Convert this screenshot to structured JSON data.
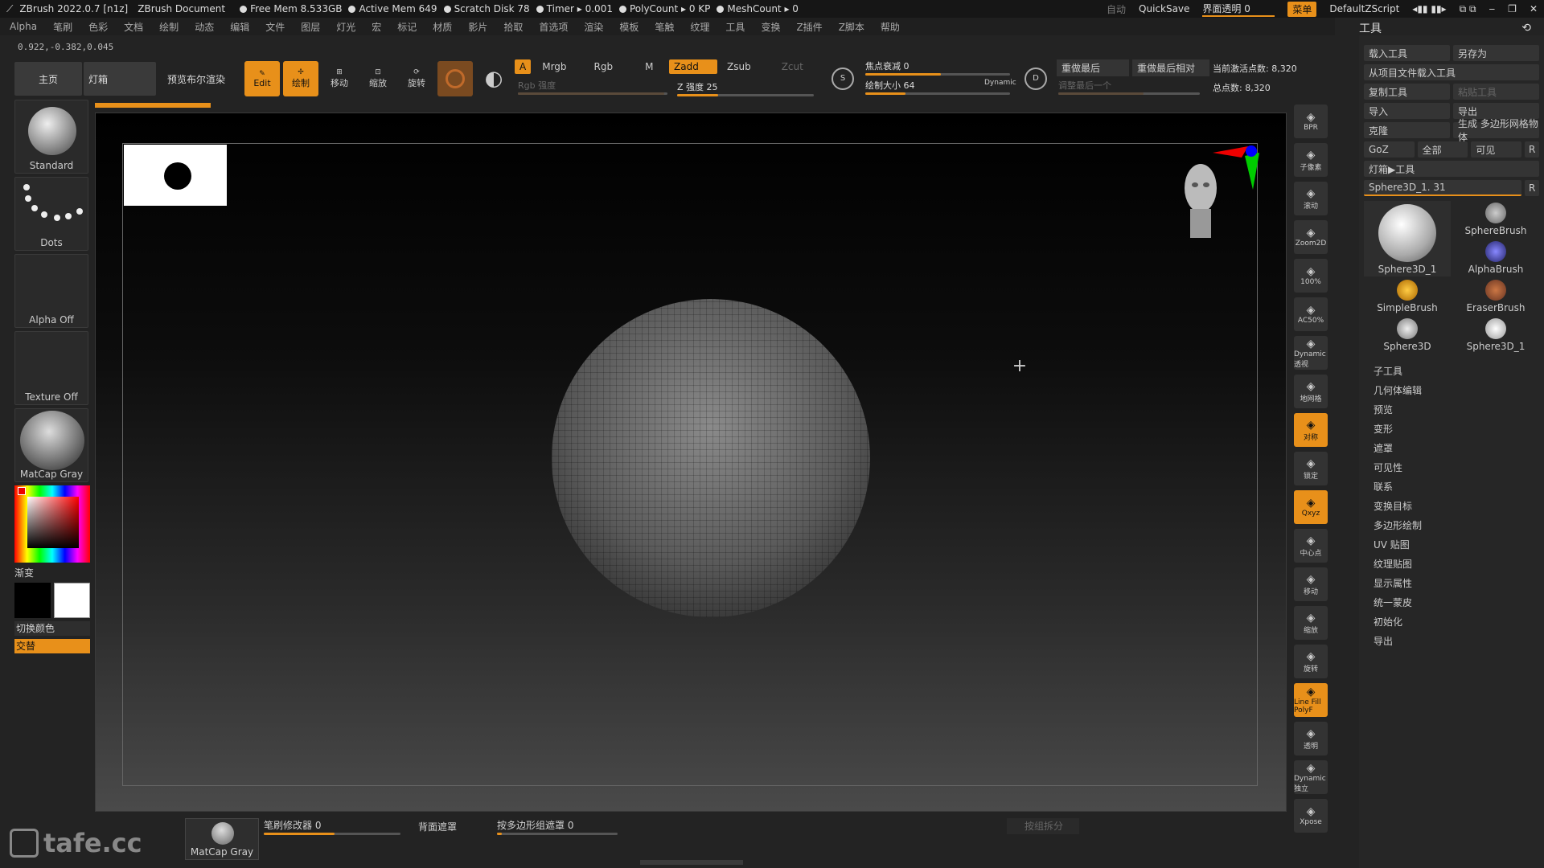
{
  "titlebar": {
    "app": "ZBrush 2022.0.7 [n1z]",
    "doc": "ZBrush Document",
    "stats": [
      "Free Mem 8.533GB",
      "Active Mem 649",
      "Scratch Disk 78",
      "Timer ▸ 0.001",
      "PolyCount ▸ 0 KP",
      "MeshCount ▸ 0"
    ],
    "auto": "自动",
    "quicksave": "QuickSave",
    "ui_transparency": "界面透明 0",
    "menu_btn": "菜单",
    "script": "DefaultZScript"
  },
  "menubar": [
    "Alpha",
    "笔刷",
    "色彩",
    "文档",
    "绘制",
    "动态",
    "编辑",
    "文件",
    "图层",
    "灯光",
    "宏",
    "标记",
    "材质",
    "影片",
    "拾取",
    "首选项",
    "渲染",
    "模板",
    "笔触",
    "纹理",
    "工具",
    "变换",
    "Z插件",
    "Z脚本",
    "帮助"
  ],
  "coords": "0.922,-0.382,0.045",
  "top_tabs": {
    "home": "主页",
    "lightbox": "灯箱",
    "preview": "预览布尔渲染"
  },
  "top_tools": [
    {
      "label": "Edit",
      "active": true
    },
    {
      "label": "绘制",
      "active": true
    },
    {
      "label": "移动",
      "active": false
    },
    {
      "label": "缩放",
      "active": false
    },
    {
      "label": "旋转",
      "active": false
    }
  ],
  "color_modes": {
    "a": "A",
    "mrgb": "Mrgb",
    "rgb": "Rgb",
    "m": "M",
    "rgb_intensity": "Rgb 强度"
  },
  "z_modes": {
    "zadd": "Zadd",
    "zsub": "Zsub",
    "zcut": "Zcut",
    "z_intensity": "Z 强度 25"
  },
  "focal": {
    "label": "焦点衰减 0",
    "draw_size": "绘制大小 64",
    "dynamic": "Dynamic"
  },
  "repeat": {
    "last": "重做最后",
    "last_rel": "重做最后相对",
    "adjust": "调整最后一个"
  },
  "points": {
    "active": "当前激活点数: 8,320",
    "total": "总点数: 8,320"
  },
  "left": {
    "brush": "Standard",
    "stroke": "Dots",
    "alpha": "Alpha Off",
    "texture": "Texture Off",
    "material": "MatCap Gray",
    "gradient": "渐变",
    "switch_color": "切换颜色",
    "alternate": "交替"
  },
  "right_strip": [
    "BPR",
    "子像素",
    "滚动",
    "Zoom2D",
    "100%",
    "AC50%",
    "Dynamic 透视",
    "地网格",
    "对称",
    "锁定",
    "Qxyz",
    "中心点",
    "移动",
    "缩放",
    "旋转",
    "Line Fill PolyF",
    "透明",
    "Dynamic 独立",
    "Xpose"
  ],
  "right_panel": {
    "title": "工具",
    "rows": [
      [
        "载入工具",
        "另存为"
      ],
      [
        "从项目文件载入工具"
      ],
      [
        "复制工具",
        "粘贴工具"
      ],
      [
        "导入",
        "导出"
      ],
      [
        "克隆",
        "生成 多边形网格物体"
      ],
      [
        "GoZ",
        "全部",
        "可见",
        "R"
      ]
    ],
    "lightbox_tool": "灯箱▶工具",
    "current_tool": "Sphere3D_1. 31",
    "r": "R",
    "tools": [
      "Sphere3D_1",
      "SphereBrush",
      "AlphaBrush",
      "SimpleBrush",
      "EraserBrush",
      "Sphere3D",
      "Sphere3D_1"
    ],
    "sublist": [
      "子工具",
      "几何体编辑",
      "预览",
      "变形",
      "遮罩",
      "可见性",
      "联系",
      "变换目标",
      "多边形绘制",
      "UV 贴图",
      "纹理贴图",
      "显示属性",
      "统一蒙皮",
      "初始化",
      "导出"
    ]
  },
  "bottom": {
    "material": "MatCap Gray",
    "brush_mod": "笔刷修改器 0",
    "backface": "背面遮罩",
    "polygroup_mask": "按多边形组遮罩 0",
    "group_split": "按组拆分"
  },
  "watermark": "tafe.cc",
  "colors": {
    "accent": "#e8901a",
    "bg": "#232323"
  }
}
